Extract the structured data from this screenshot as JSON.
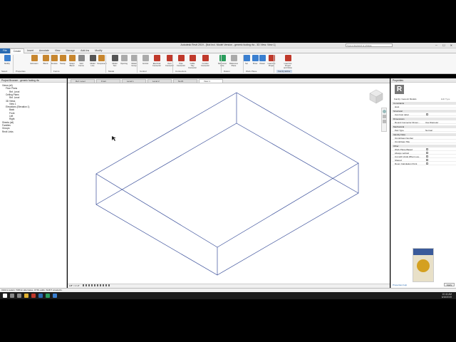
{
  "window": {
    "title": "Autodesk Revit 2019 - [Not Incl. Model Version - generic footing rfa - 3D View: View 1]",
    "search_placeholder": "Type a keyword or phrase",
    "controls": "─ ☐ ✕"
  },
  "ribbon_tabs": [
    "File",
    "Create",
    "Insert",
    "Annotate",
    "View",
    "Manage",
    "Add-Ins",
    "Modify"
  ],
  "ribbon": {
    "buttons": [
      {
        "label": "Modify",
        "color": "#3a7fd0"
      },
      {
        "label": "Extrusion",
        "color": "#c7862e"
      },
      {
        "label": "Blend",
        "color": "#c7862e"
      },
      {
        "label": "Revolve",
        "color": "#c7862e"
      },
      {
        "label": "Sweep",
        "color": "#c7862e"
      },
      {
        "label": "Swept Blend",
        "color": "#c7862e"
      },
      {
        "label": "Void Forms",
        "color": "#888888"
      },
      {
        "label": "Model Line",
        "color": "#555555"
      },
      {
        "label": "Component",
        "color": "#c7862e"
      },
      {
        "label": "Model Text",
        "color": "#555555"
      },
      {
        "label": "Opening",
        "color": "#aaaaaa"
      },
      {
        "label": "Model Group",
        "color": "#aaaaaa"
      },
      {
        "label": "Control",
        "color": "#aaaaaa"
      },
      {
        "label": "Electrical Connector",
        "color": "#c0392b"
      },
      {
        "label": "Duct Connector",
        "color": "#c0392b"
      },
      {
        "label": "Pipe Connector",
        "color": "#c0392b"
      },
      {
        "label": "Cable Tray Connector",
        "color": "#c0392b"
      },
      {
        "label": "Conduit Connector",
        "color": "#c0392b"
      },
      {
        "label": "Reference Line",
        "color": "#2a9d5c"
      },
      {
        "label": "Reference Plane",
        "color": "#aaaaaa"
      },
      {
        "label": "Set",
        "color": "#3a7fd0"
      },
      {
        "label": "Show",
        "color": "#3a7fd0"
      },
      {
        "label": "Viewer",
        "color": "#3a7fd0"
      },
      {
        "label": "Load into Project",
        "color": "#c0392b"
      },
      {
        "label": "Load into Project and Close",
        "color": "#c0392b"
      }
    ],
    "panels": [
      "Select",
      "Properties",
      "Forms",
      "Model",
      "Control",
      "Connectors",
      "Datum",
      "Work Plane",
      "Family Editor"
    ]
  },
  "view_tabs": [
    "Ref. Level",
    "Front",
    "Level 1",
    "Level 2",
    "North",
    "View 1"
  ],
  "project_browser": {
    "title": "Project Browser - generic footing rfa",
    "items": [
      {
        "label": "Views (all)",
        "indent": 0
      },
      {
        "label": "Floor Plans",
        "indent": 1
      },
      {
        "label": "Ref. Level",
        "indent": 2
      },
      {
        "label": "Ceiling Plans",
        "indent": 1
      },
      {
        "label": "Ref. Level",
        "indent": 2
      },
      {
        "label": "3D Views",
        "indent": 1
      },
      {
        "label": "View 1",
        "indent": 2
      },
      {
        "label": "Elevations (Elevation 1)",
        "indent": 1
      },
      {
        "label": "Back",
        "indent": 2
      },
      {
        "label": "Front",
        "indent": 2
      },
      {
        "label": "Left",
        "indent": 2
      },
      {
        "label": "Right",
        "indent": 2
      },
      {
        "label": "Sheets (all)",
        "indent": 0
      },
      {
        "label": "Families",
        "indent": 0
      },
      {
        "label": "Groups",
        "indent": 0
      },
      {
        "label": "Revit Links",
        "indent": 0
      }
    ]
  },
  "view_control_bar": "1/8\" = 1'-0\"",
  "properties": {
    "title": "Properties",
    "family_label": "Family: Generic Models",
    "edit_type": "Edit Type",
    "sections": [
      {
        "name": "Constraints",
        "rows": [
          {
            "k": "Host",
            "v": ""
          }
        ]
      },
      {
        "name": "Structural",
        "rows": [
          {
            "k": "Can host rebar",
            "v": "check"
          }
        ]
      },
      {
        "name": "Dimensions",
        "rows": [
          {
            "k": "Round Connector Dimen...",
            "v": "Use Diameter"
          }
        ]
      },
      {
        "name": "Mechanical",
        "rows": [
          {
            "k": "Part Type",
            "v": "Normal"
          }
        ]
      },
      {
        "name": "Identity Data",
        "rows": [
          {
            "k": "OmniClass Number",
            "v": ""
          },
          {
            "k": "OmniClass Title",
            "v": ""
          }
        ]
      },
      {
        "name": "Other",
        "rows": [
          {
            "k": "Work Plane-Based",
            "v": "check"
          },
          {
            "k": "Always vertical",
            "v": "check"
          },
          {
            "k": "Cut with Voids When Loa...",
            "v": "check"
          },
          {
            "k": "Shared",
            "v": "check"
          },
          {
            "k": "Room Calculation Point",
            "v": "check"
          }
        ]
      }
    ],
    "help_link": "Properties help",
    "apply": "Apply"
  },
  "status": "Click to select, TAB for alternates, CTRL adds, SHIFT unselects.",
  "clock": {
    "time": "10:44 AM",
    "date": "6/16/2019"
  }
}
